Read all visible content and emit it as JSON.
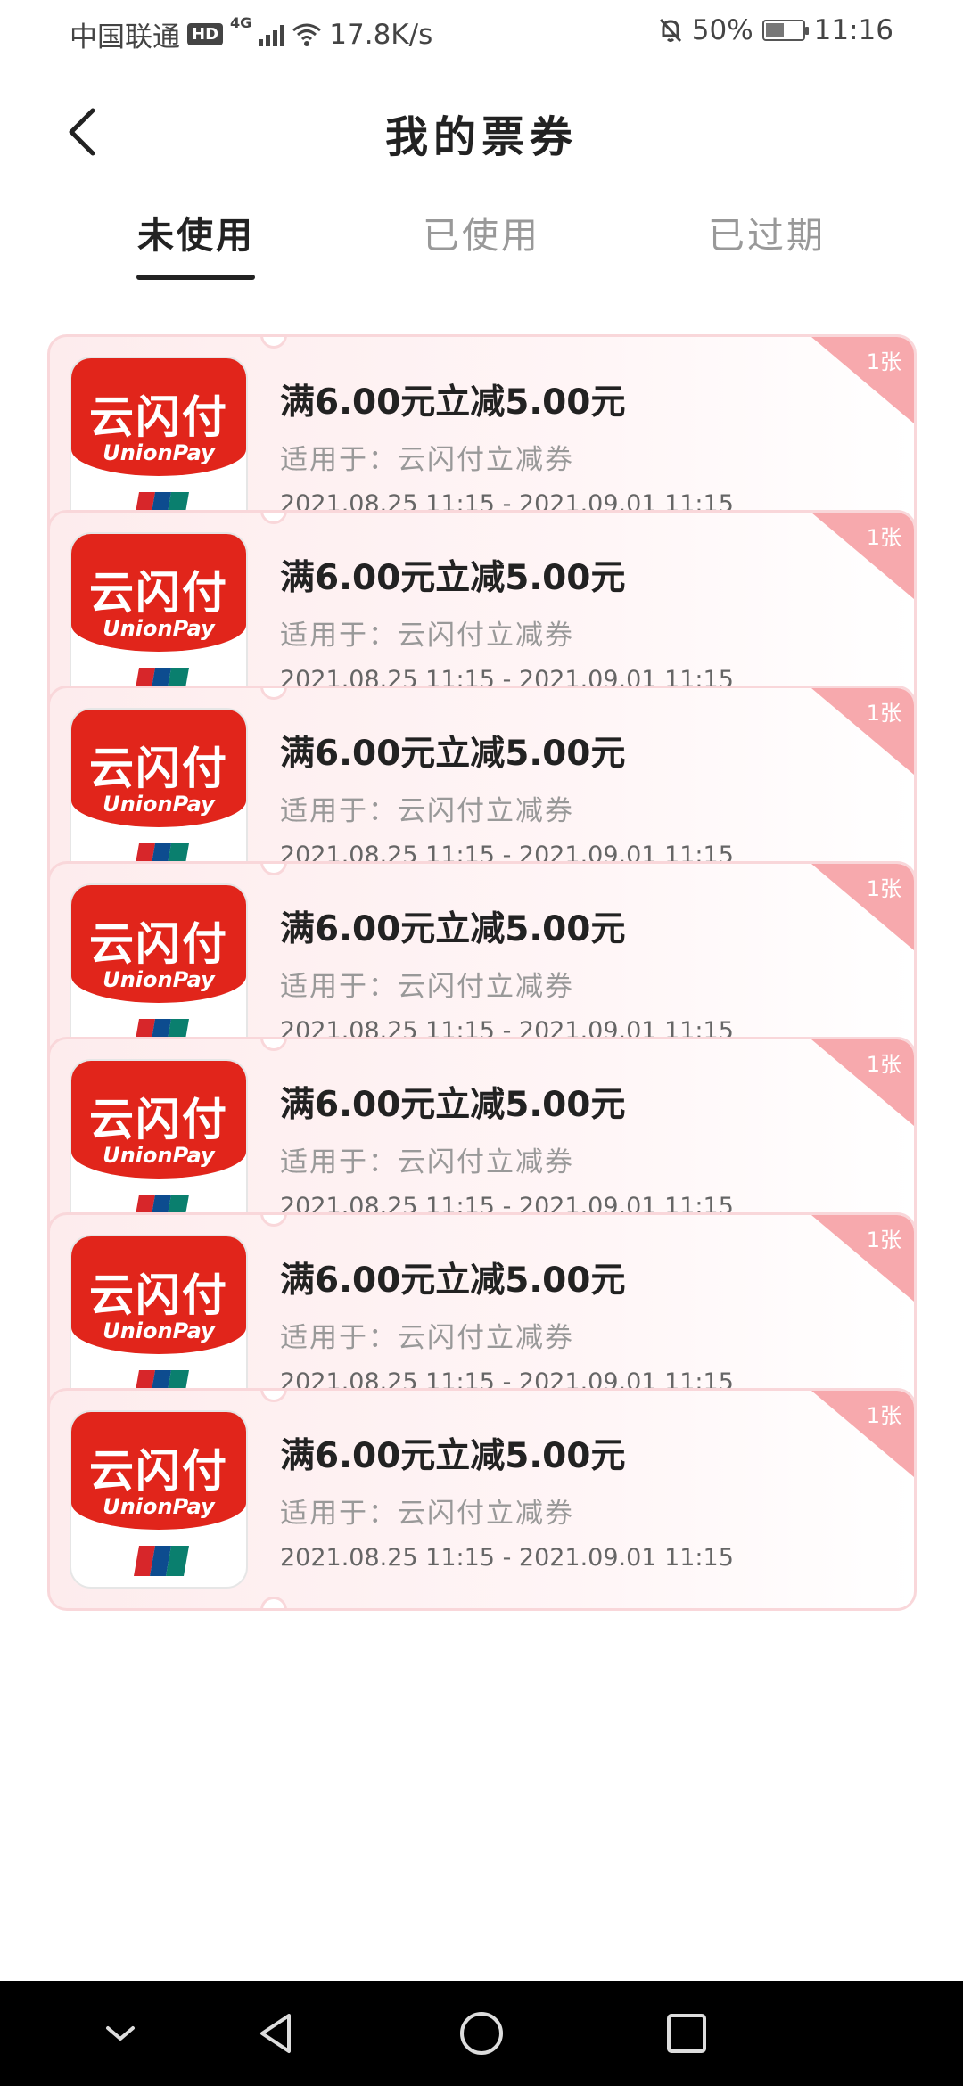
{
  "status_bar": {
    "carrier": "中国联通",
    "hd_badge": "HD",
    "network": "4G",
    "speed": "17.8K/s",
    "battery_percent": "50%",
    "battery_level": 0.5,
    "time": "11:16",
    "icons": [
      "hd-icon",
      "signal-icon",
      "wifi-icon",
      "mute-icon",
      "battery-icon"
    ]
  },
  "header": {
    "title": "我的票券",
    "back_icon": "chevron-left-icon"
  },
  "tabs": [
    {
      "label": "未使用",
      "active": true
    },
    {
      "label": "已使用",
      "active": false
    },
    {
      "label": "已过期",
      "active": false
    }
  ],
  "coupons": [
    {
      "title": "满6.00元立减5.00元",
      "scope": "适用于：云闪付立减券",
      "validity": "2021.08.25 11:15 - 2021.09.01 11:15",
      "count": "1张",
      "logo_cn": "云闪付",
      "logo_en": "UnionPay"
    },
    {
      "title": "满6.00元立减5.00元",
      "scope": "适用于：云闪付立减券",
      "validity": "2021.08.25 11:15 - 2021.09.01 11:15",
      "count": "1张",
      "logo_cn": "云闪付",
      "logo_en": "UnionPay"
    },
    {
      "title": "满6.00元立减5.00元",
      "scope": "适用于：云闪付立减券",
      "validity": "2021.08.25 11:15 - 2021.09.01 11:15",
      "count": "1张",
      "logo_cn": "云闪付",
      "logo_en": "UnionPay"
    },
    {
      "title": "满6.00元立减5.00元",
      "scope": "适用于：云闪付立减券",
      "validity": "2021.08.25 11:15 - 2021.09.01 11:15",
      "count": "1张",
      "logo_cn": "云闪付",
      "logo_en": "UnionPay"
    },
    {
      "title": "满6.00元立减5.00元",
      "scope": "适用于：云闪付立减券",
      "validity": "2021.08.25 11:15 - 2021.09.01 11:15",
      "count": "1张",
      "logo_cn": "云闪付",
      "logo_en": "UnionPay"
    },
    {
      "title": "满6.00元立减5.00元",
      "scope": "适用于：云闪付立减券",
      "validity": "2021.08.25 11:15 - 2021.09.01 11:15",
      "count": "1张",
      "logo_cn": "云闪付",
      "logo_en": "UnionPay"
    },
    {
      "title": "满6.00元立减5.00元",
      "scope": "适用于：云闪付立减券",
      "validity": "2021.08.25 11:15 - 2021.09.01 11:15",
      "count": "1张",
      "logo_cn": "云闪付",
      "logo_en": "UnionPay"
    }
  ],
  "nav_bar": {
    "buttons": [
      "collapse-icon",
      "back-triangle-icon",
      "home-circle-icon",
      "recents-square-icon"
    ]
  },
  "colors": {
    "accent_red": "#e1251b",
    "coupon_border": "#f9d7da",
    "corner_badge": "#f7a9ad"
  }
}
